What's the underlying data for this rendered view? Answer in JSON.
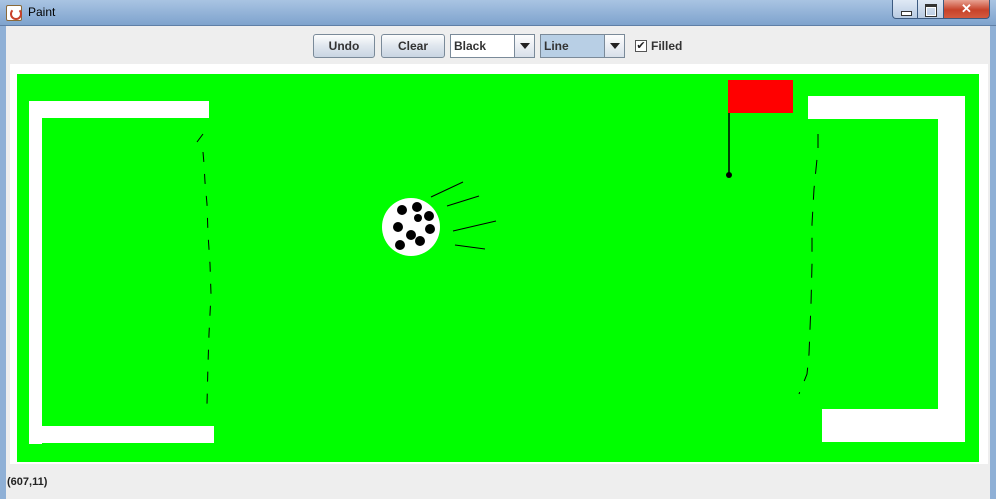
{
  "window": {
    "title": "Paint"
  },
  "toolbar": {
    "undo_label": "Undo",
    "clear_label": "Clear",
    "color_value": "Black",
    "shape_value": "Line",
    "filled_label": "Filled",
    "filled_checked": true
  },
  "status": {
    "coords": "(607,11)"
  },
  "colors": {
    "field": "#00ff00",
    "flag": "#ff0000",
    "lines": "#ffffff"
  }
}
